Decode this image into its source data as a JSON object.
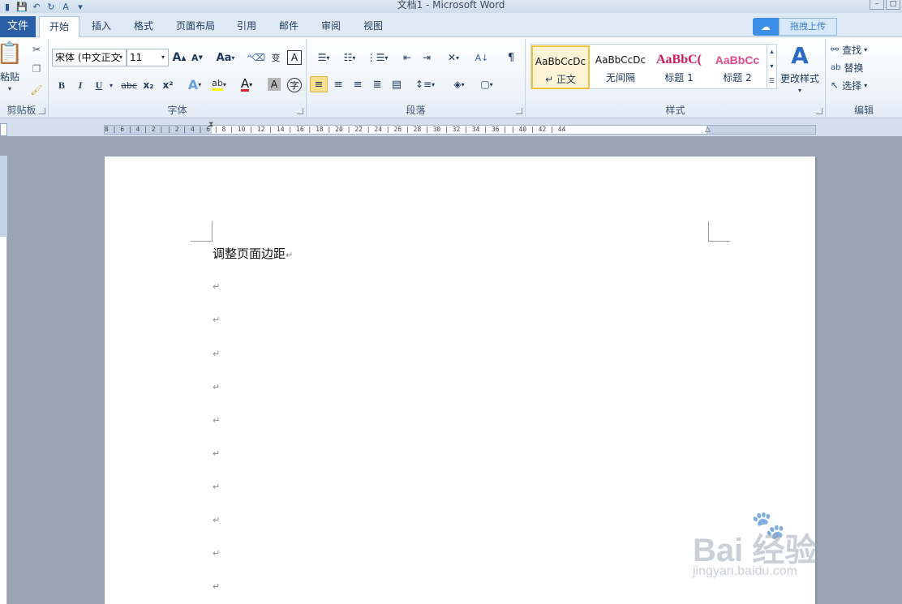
{
  "window": {
    "title": "文档1 - Microsoft Word"
  },
  "tabs": {
    "file": "文件",
    "items": [
      "开始",
      "插入",
      "格式",
      "页面布局",
      "引用",
      "邮件",
      "审阅",
      "视图"
    ]
  },
  "upload": {
    "label": "拖拽上传"
  },
  "clipboard": {
    "paste": "粘贴",
    "group": "剪贴板"
  },
  "font": {
    "name": "宋体 (中文正文",
    "size": "11",
    "group": "字体",
    "grow": "A",
    "shrink": "A",
    "case": "Aa",
    "bold": "B",
    "italic": "I",
    "underline": "U",
    "strike": "abc",
    "sub": "x₂",
    "sup": "x²"
  },
  "paragraph": {
    "group": "段落"
  },
  "styles": {
    "group": "样式",
    "items": [
      {
        "sample": "AaBbCcDc",
        "name": "↵ 正文"
      },
      {
        "sample": "AaBbCcDc",
        "name": "无间隔"
      },
      {
        "sample": "AaBbC(",
        "name": "标题 1"
      },
      {
        "sample": "AaBbCc",
        "name": "标题 2"
      }
    ],
    "change": "更改样式"
  },
  "editing": {
    "group": "编辑",
    "find": "查找",
    "replace": "替换",
    "select": "选择"
  },
  "ruler": {
    "labels": "8 | 6 | 4 | 2 |   | 2 | 4 | 6 | 8 | 10 | 12 | 14 | 16 | 18 | 20 | 22 | 24 | 26 | 28 | 30 | 32 | 34 | 36 |   | 40 | 42 | 44"
  },
  "document": {
    "lines": [
      "调整页面边距",
      "",
      "",
      "",
      "",
      "",
      "",
      "",
      "",
      "",
      ""
    ],
    "para_mark": "↵"
  },
  "watermark": {
    "brand": "Bai 经验",
    "url": "jingyan.baidu.com"
  },
  "colors": {
    "file_tab": "#2a5ea6",
    "highlight": "#ffff00",
    "font_color": "#e02020",
    "heading1": "#d0185c",
    "heading2": "#e64a8a"
  }
}
